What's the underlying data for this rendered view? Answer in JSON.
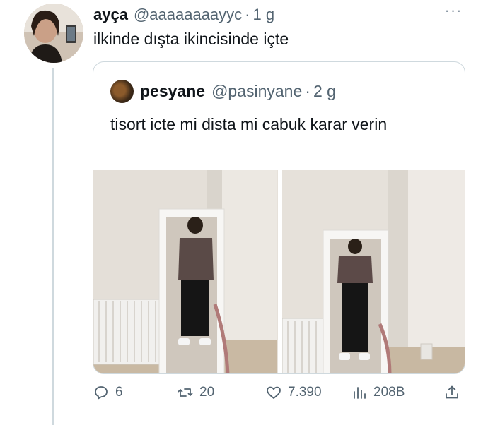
{
  "tweet": {
    "display_name": "ayça",
    "handle": "@aaaaaaaayyc",
    "separator": "·",
    "time": "1 g",
    "text": "ilkinde dışta ikincisinde içte",
    "more_label": "···"
  },
  "quoted": {
    "display_name": "pesyane",
    "handle": "@pasinyane",
    "separator": "·",
    "time": "2 g",
    "text": "tisort icte mi dista mi cabuk karar verin"
  },
  "actions": {
    "reply_count": "6",
    "retweet_count": "20",
    "like_count": "7.390",
    "view_count": "208B"
  },
  "icons": [
    "reply-icon",
    "retweet-icon",
    "like-icon",
    "views-icon",
    "share-icon"
  ],
  "colors": {
    "text": "#0f1419",
    "secondary": "#536471",
    "border": "#cfd9de"
  }
}
